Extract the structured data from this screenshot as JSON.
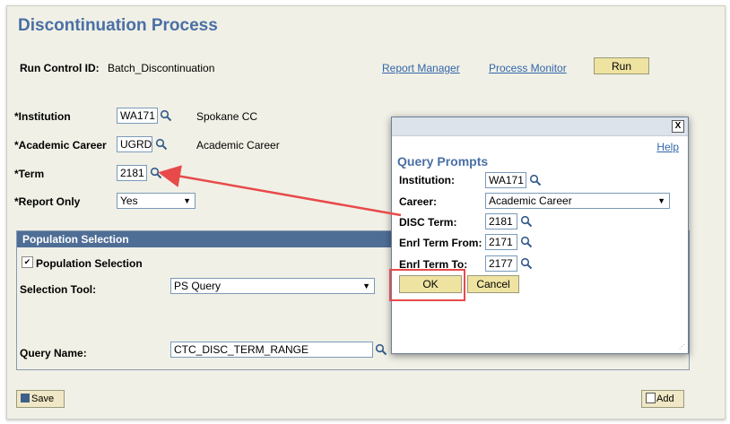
{
  "page": {
    "title": "Discontinuation Process",
    "run_control_label": "Run Control ID:",
    "run_control_value": "Batch_Discontinuation",
    "report_manager": "Report Manager",
    "process_monitor": "Process Monitor",
    "run_button": "Run"
  },
  "form": {
    "institution_label": "*Institution",
    "institution_value": "WA171",
    "institution_desc": "Spokane CC",
    "career_label": "*Academic Career",
    "career_value": "UGRD",
    "career_desc": "Academic Career",
    "term_label": "*Term",
    "term_value": "2181",
    "report_only_label": "*Report Only",
    "report_only_value": "Yes"
  },
  "population": {
    "header": "Population Selection",
    "checkbox_label": "Population Selection",
    "checked": true,
    "tool_label": "Selection Tool:",
    "tool_value": "PS Query",
    "query_label": "Query Name:",
    "query_value": "CTC_DISC_TERM_RANGE"
  },
  "footer": {
    "save": "Save",
    "add": "Add"
  },
  "dialog": {
    "close": "X",
    "help": "Help",
    "title": "Query Prompts",
    "institution_label": "Institution:",
    "institution_value": "WA171",
    "career_label": "Career:",
    "career_value": "Academic Career",
    "disc_term_label": "DISC Term:",
    "disc_term_value": "2181",
    "enrl_from_label": "Enrl Term From:",
    "enrl_from_value": "2171",
    "enrl_to_label": "Enrl Term To:",
    "enrl_to_value": "2177",
    "ok": "OK",
    "cancel": "Cancel"
  },
  "colors": {
    "accent": "#4a6fa5",
    "button_bg": "#efe3a2",
    "callout": "#e84a4a"
  }
}
